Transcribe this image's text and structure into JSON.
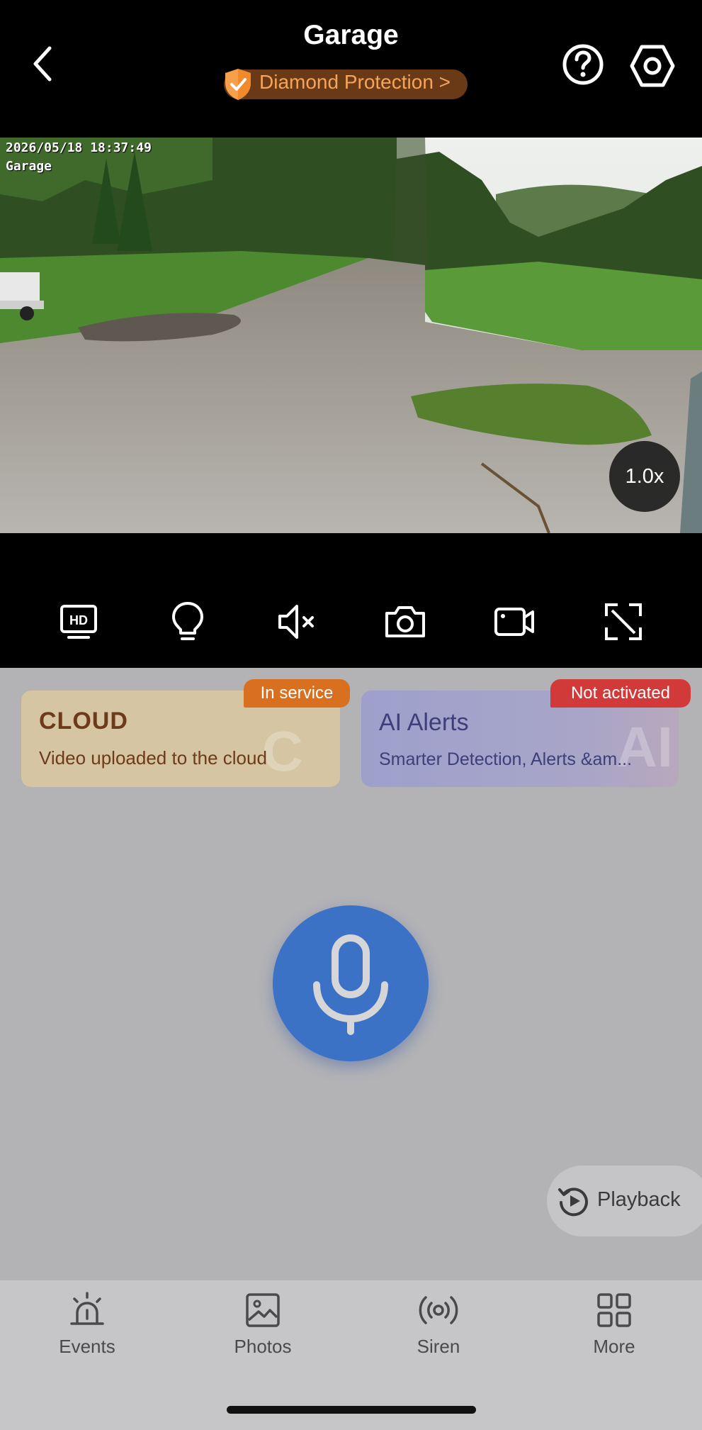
{
  "header": {
    "title": "Garage",
    "plan_badge": "Diamond Protection >"
  },
  "video": {
    "timestamp": "2026/05/18 18:37:49",
    "camera_name": "Garage",
    "zoom": "1.0x"
  },
  "toolbar": {
    "items": [
      "hd-icon",
      "light-bulb-icon",
      "mute-icon",
      "camera-snapshot-icon",
      "video-record-icon",
      "fullscreen-icon"
    ]
  },
  "cards": {
    "cloud": {
      "tag": "In service",
      "title": "CLOUD",
      "subtitle": "Video uploaded to the cloud"
    },
    "ai": {
      "tag": "Not activated",
      "title": "AI Alerts",
      "subtitle": "Smarter Detection, Alerts &am..."
    }
  },
  "playback": {
    "label": "Playback"
  },
  "nav": {
    "items": [
      {
        "label": "Events",
        "icon": "siren-light-icon"
      },
      {
        "label": "Photos",
        "icon": "image-icon"
      },
      {
        "label": "Siren",
        "icon": "broadcast-icon"
      },
      {
        "label": "More",
        "icon": "grid-icon"
      }
    ]
  },
  "colors": {
    "accent_blue": "#3b72c6",
    "badge_orange": "#f4a55b",
    "tag_in_service": "#d8701f",
    "tag_not_activated": "#d23a3a"
  }
}
